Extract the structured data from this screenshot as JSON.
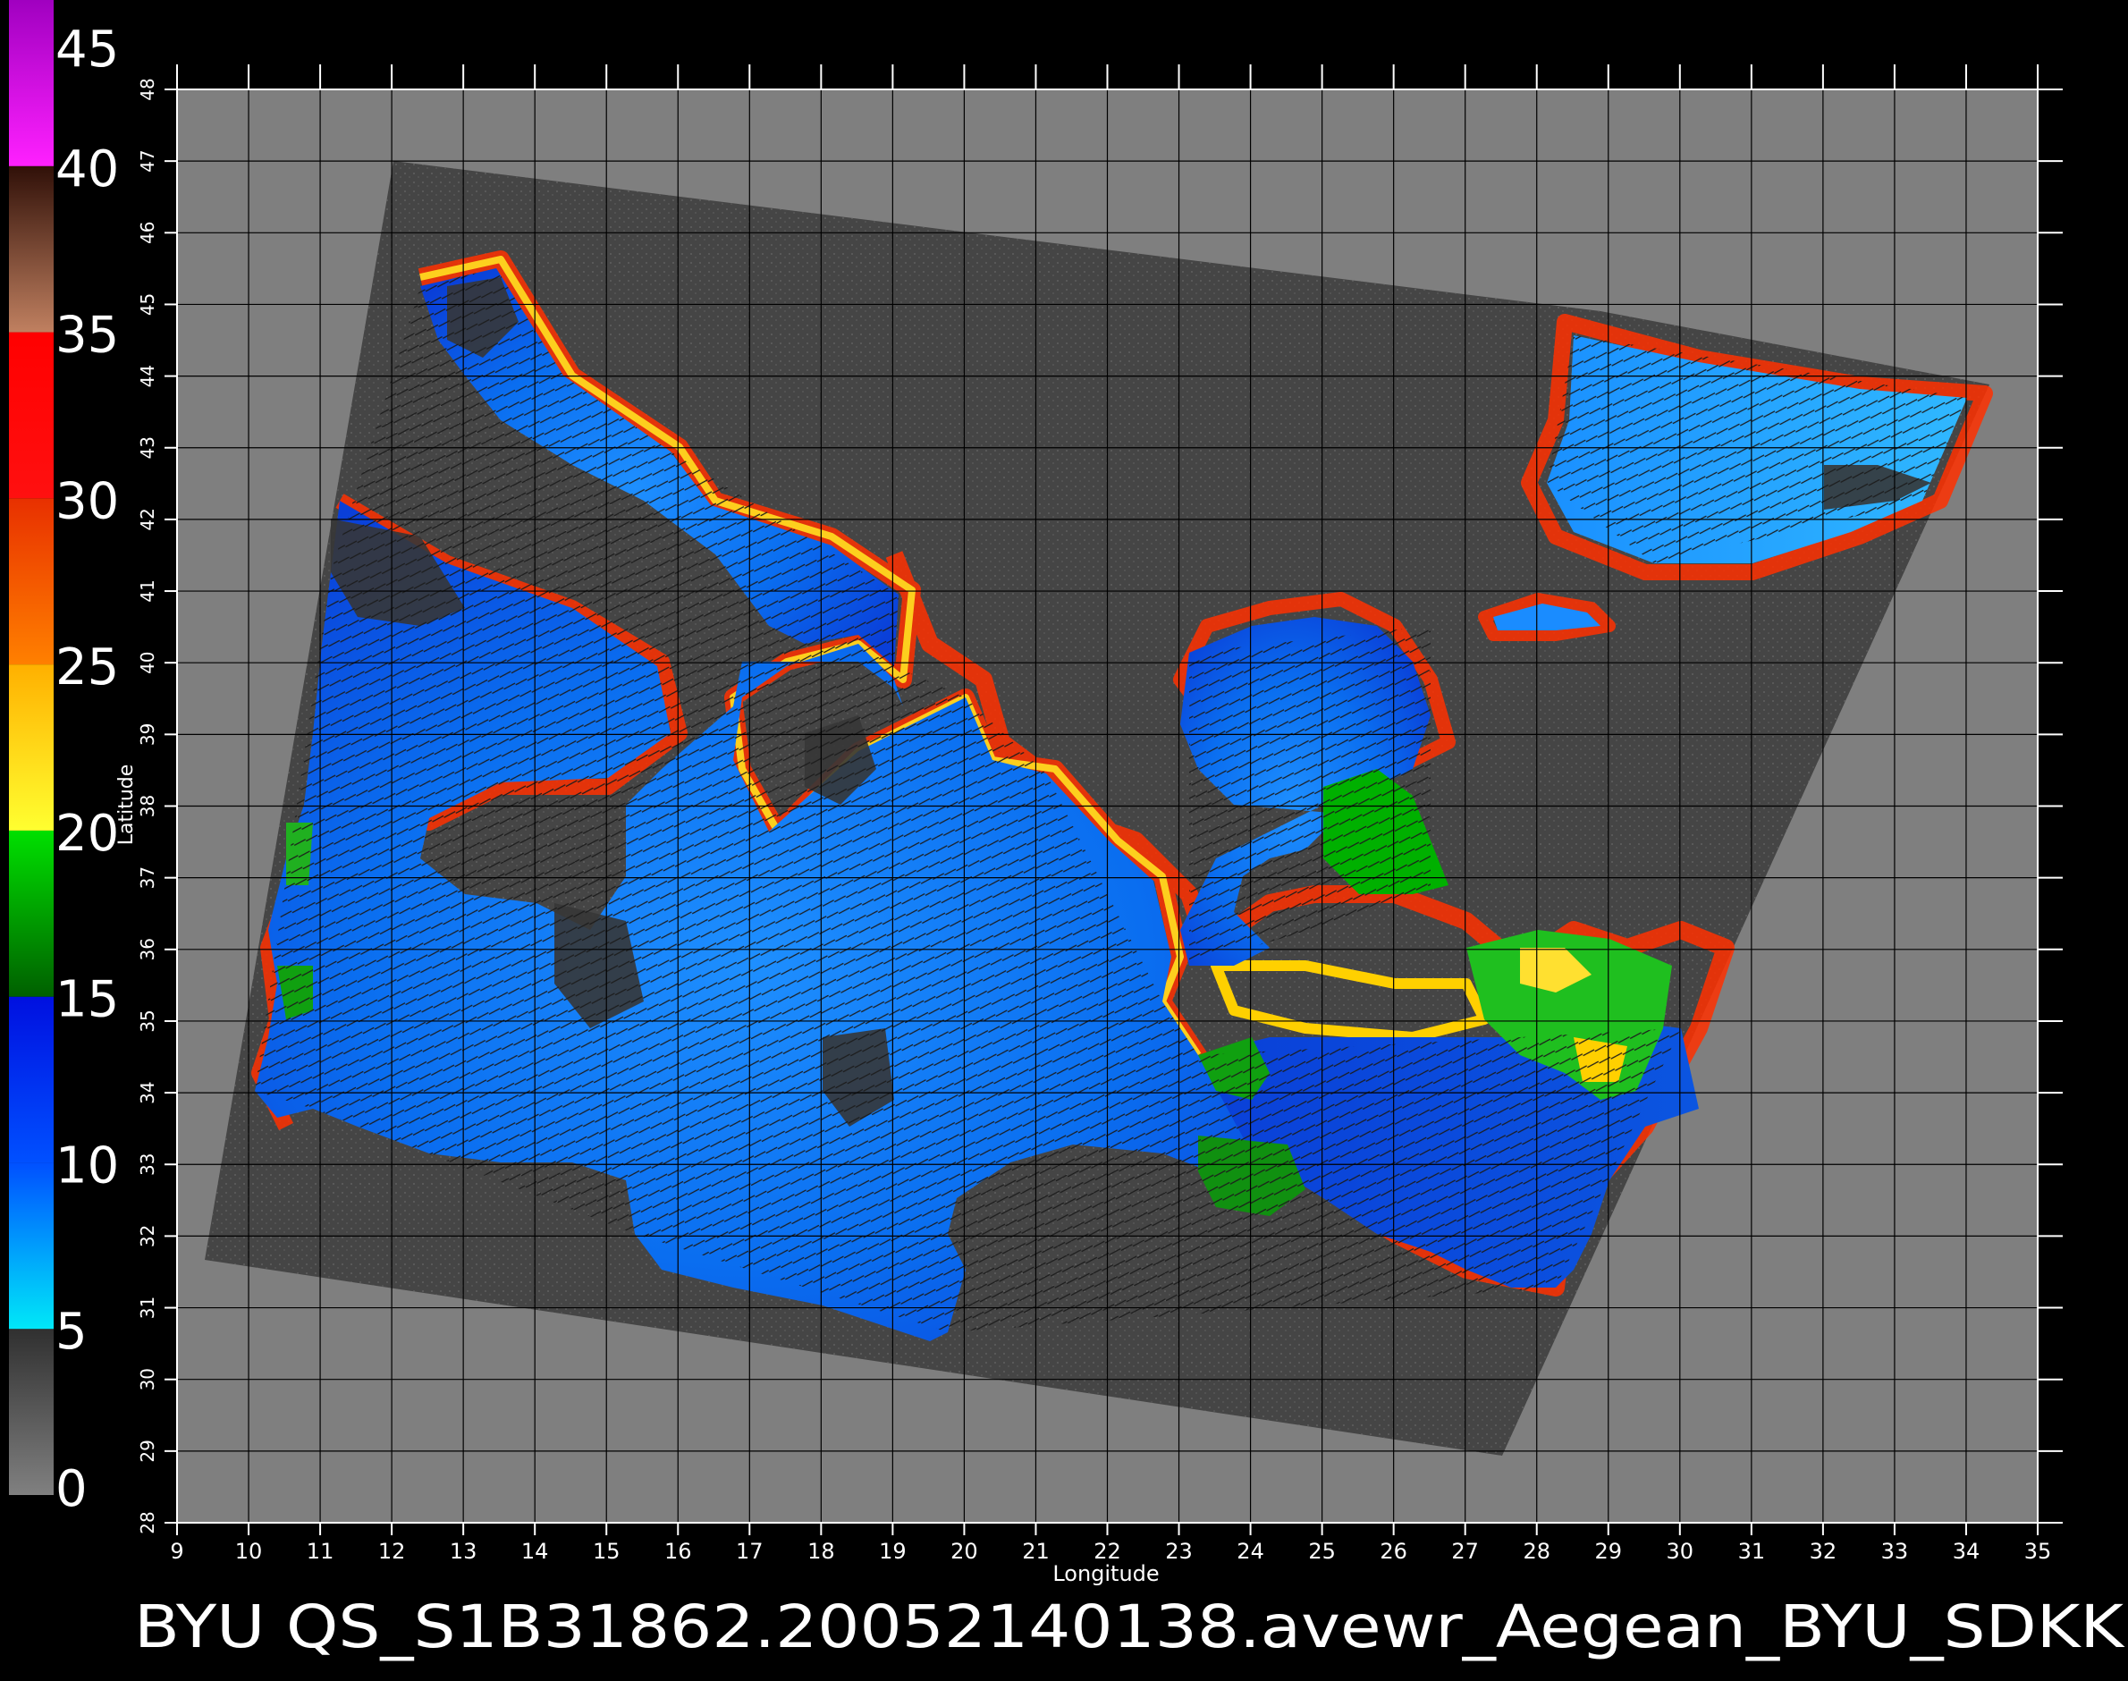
{
  "title": "BYU  QS_S1B31862.20052140138.avewr_Aegean_BYU_SDKK",
  "axes": {
    "xlabel": "Longitude",
    "ylabel": "Latitude",
    "lon_range": [
      9,
      35
    ],
    "lat_range": [
      28,
      48
    ],
    "lon_ticks": [
      "9",
      "10",
      "11",
      "12",
      "13",
      "14",
      "15",
      "16",
      "17",
      "18",
      "19",
      "20",
      "21",
      "22",
      "23",
      "24",
      "25",
      "26",
      "27",
      "28",
      "29",
      "30",
      "31",
      "32",
      "33",
      "34",
      "35"
    ],
    "lat_ticks": [
      "28",
      "29",
      "30",
      "31",
      "32",
      "33",
      "34",
      "35",
      "36",
      "37",
      "38",
      "39",
      "40",
      "41",
      "42",
      "43",
      "44",
      "45",
      "46",
      "47",
      "48"
    ],
    "grid": true
  },
  "colorbar": {
    "labels": [
      "0",
      "5",
      "10",
      "15",
      "20",
      "25",
      "30",
      "35",
      "40",
      "45"
    ],
    "segments": [
      {
        "from": 0,
        "to": 5,
        "colors": [
          "#808080",
          "#303030"
        ]
      },
      {
        "from": 5,
        "to": 10,
        "colors": [
          "#00e8f8",
          "#0050ff"
        ]
      },
      {
        "from": 10,
        "to": 15,
        "colors": [
          "#0050ff",
          "#0010e0"
        ]
      },
      {
        "from": 15,
        "to": 20,
        "colors": [
          "#006000",
          "#00e000"
        ]
      },
      {
        "from": 20,
        "to": 25,
        "colors": [
          "#ffff30",
          "#ffb000"
        ]
      },
      {
        "from": 25,
        "to": 30,
        "colors": [
          "#ff8000",
          "#e83000"
        ]
      },
      {
        "from": 30,
        "to": 35,
        "colors": [
          "#ff1010",
          "#ff0000"
        ]
      },
      {
        "from": 35,
        "to": 40,
        "colors": [
          "#c08060",
          "#301008"
        ]
      },
      {
        "from": 40,
        "to": 45,
        "colors": [
          "#ff20ff",
          "#a000c0"
        ]
      }
    ]
  },
  "colors": {
    "background": "#000000",
    "plot_fill": "#7f7f7f",
    "swath": "#454545",
    "grid": "#000000",
    "text": "#ffffff"
  }
}
